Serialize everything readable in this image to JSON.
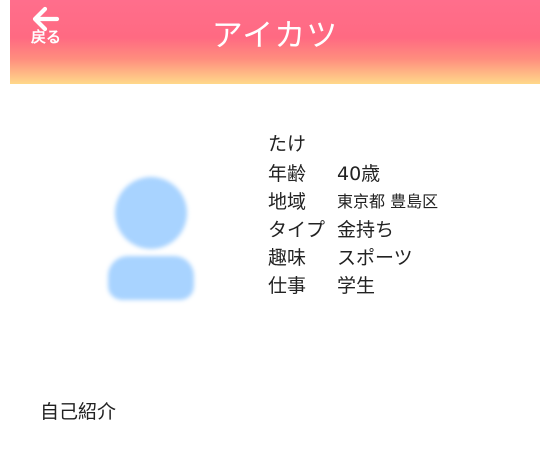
{
  "header": {
    "back_label": "戻る",
    "title": "アイカツ"
  },
  "profile": {
    "name": "たけ",
    "rows": [
      {
        "label": "年齢",
        "value": "40歳"
      },
      {
        "label": "地域",
        "value": "東京都 豊島区"
      },
      {
        "label": "タイプ",
        "value": "金持ち"
      },
      {
        "label": "趣味",
        "value": "スポーツ"
      },
      {
        "label": "仕事",
        "value": "学生"
      }
    ]
  },
  "intro": {
    "heading": "自己紹介"
  },
  "colors": {
    "header_top": "#ff6e8c",
    "header_bottom": "#ffd98a",
    "avatar": "#a8d3ff"
  },
  "icons": {
    "back": "arrow-left-icon",
    "avatar": "person-placeholder-icon"
  }
}
